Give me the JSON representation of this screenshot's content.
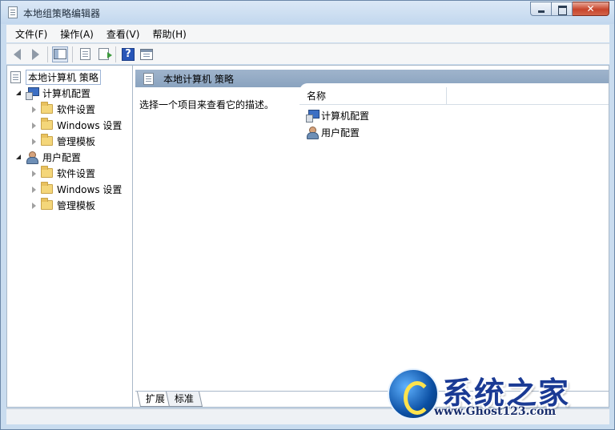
{
  "window": {
    "title": "本地组策略编辑器"
  },
  "menu": [
    {
      "label": "文件(F)"
    },
    {
      "label": "操作(A)"
    },
    {
      "label": "查看(V)"
    },
    {
      "label": "帮助(H)"
    }
  ],
  "toolbar": {
    "help_glyph": "?"
  },
  "tree": {
    "root": "本地计算机 策略",
    "computer_config": "计算机配置",
    "user_config": "用户配置",
    "software_settings": "软件设置",
    "windows_settings": "Windows 设置",
    "admin_templates": "管理模板"
  },
  "panel": {
    "header": "本地计算机 策略",
    "description": "选择一个项目来查看它的描述。",
    "column_name": "名称",
    "items": [
      {
        "label": "计算机配置"
      },
      {
        "label": "用户配置"
      }
    ]
  },
  "tabs": [
    {
      "label": "扩展"
    },
    {
      "label": "标准"
    }
  ],
  "watermark": {
    "text": "系统之家",
    "url": "www.Ghost123.com"
  }
}
